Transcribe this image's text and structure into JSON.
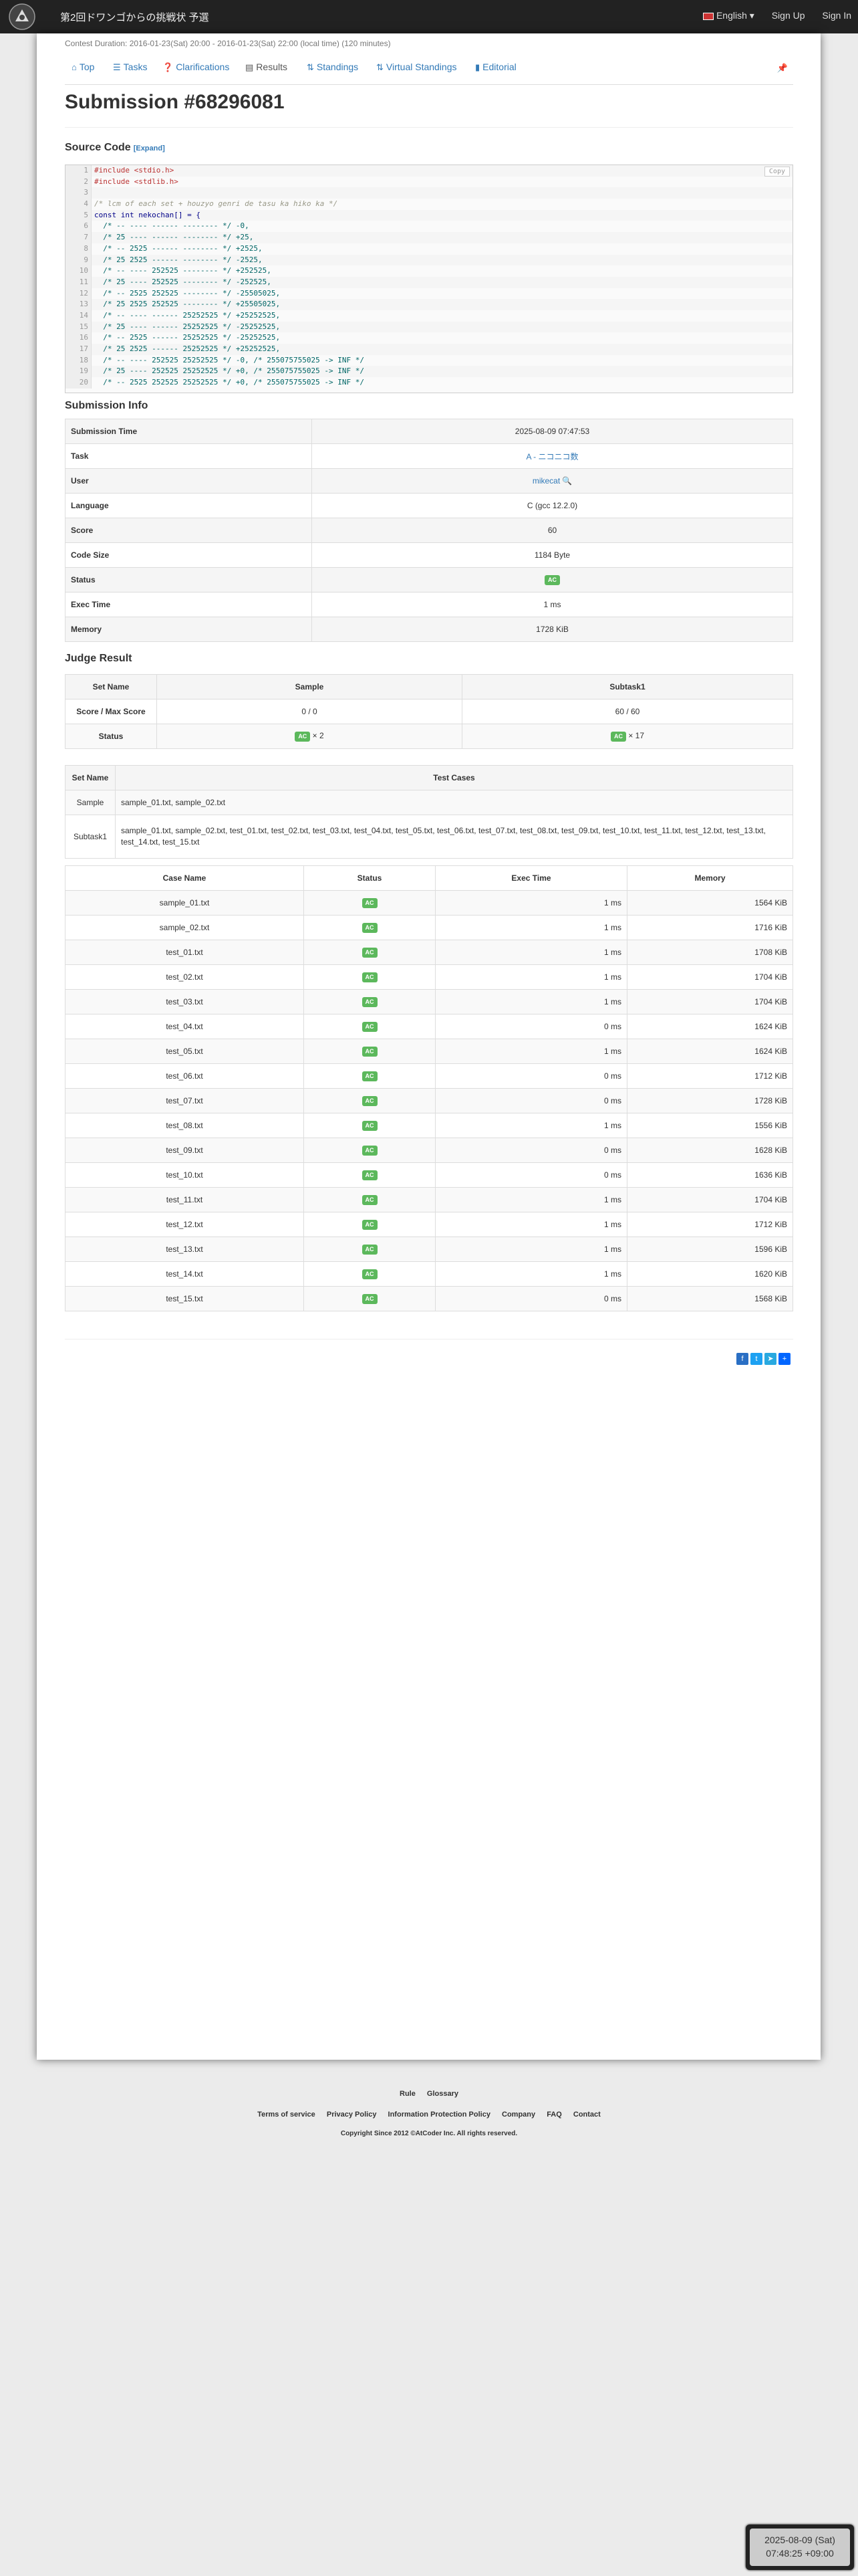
{
  "navbar": {
    "brand": "第2回ドワンゴからの挑戦状 予選",
    "language": "English",
    "sign_up": "Sign Up",
    "sign_in": "Sign In"
  },
  "contest_duration": "Contest Duration: 2016-01-23(Sat) 20:00 - 2016-01-23(Sat) 22:00 (local time) (120 minutes)",
  "tabs": [
    "Top",
    "Tasks",
    "Clarifications",
    "Results",
    "Standings",
    "Virtual Standings",
    "Editorial"
  ],
  "title": "Submission #68296081",
  "source_code": {
    "heading": "Source Code",
    "expand": "[Expand]",
    "copy": "Copy",
    "lines": [
      "#include <stdio.h>",
      "#include <stdlib.h>",
      "",
      "/* lcm of each set + houzyo genri de tasu ka hiko ka */",
      "const int nekochan[] = {",
      "  /* -- ---- ------ -------- */ -0,",
      "  /* 25 ---- ------ -------- */ +25,",
      "  /* -- 2525 ------ -------- */ +2525,",
      "  /* 25 2525 ------ -------- */ -2525,",
      "  /* -- ---- 252525 -------- */ +252525,",
      "  /* 25 ---- 252525 -------- */ -252525,",
      "  /* -- 2525 252525 -------- */ -25505025,",
      "  /* 25 2525 252525 -------- */ +25505025,",
      "  /* -- ---- ------ 25252525 */ +25252525,",
      "  /* 25 ---- ------ 25252525 */ -25252525,",
      "  /* -- 2525 ------ 25252525 */ -25252525,",
      "  /* 25 2525 ------ 25252525 */ +25252525,",
      "  /* -- ---- 252525 25252525 */ -0, /* 255075755025 -> INF */",
      "  /* 25 ---- 252525 25252525 */ +0, /* 255075755025 -> INF */",
      "  /* -- 2525 252525 25252525 */ +0, /* 255075755025 -> INF */"
    ]
  },
  "submission_info": {
    "heading": "Submission Info",
    "rows": [
      {
        "key": "Submission Time",
        "value": "2025-08-09 07:47:53"
      },
      {
        "key": "Task",
        "value": "A - ニコニコ数"
      },
      {
        "key": "User",
        "value": "mikecat"
      },
      {
        "key": "Language",
        "value": "C (gcc 12.2.0)"
      },
      {
        "key": "Score",
        "value": "60"
      },
      {
        "key": "Code Size",
        "value": "1184 Byte"
      },
      {
        "key": "Status",
        "value": "AC"
      },
      {
        "key": "Exec Time",
        "value": "1 ms"
      },
      {
        "key": "Memory",
        "value": "1728 KiB"
      }
    ]
  },
  "judge_result": {
    "heading": "Judge Result",
    "headers": [
      "Set Name",
      "Sample",
      "Subtask1"
    ],
    "score_row": {
      "label": "Score / Max Score",
      "sample": "0 / 0",
      "subtask1": "60 / 60"
    },
    "status_row": {
      "label": "Status",
      "sample_badge": "AC",
      "sample_count": "× 2",
      "subtask1_badge": "AC",
      "subtask1_count": "× 17"
    }
  },
  "test_cases_table": {
    "headers": [
      "Set Name",
      "Test Cases"
    ],
    "rows": [
      {
        "set": "Sample",
        "cases": "sample_01.txt, sample_02.txt"
      },
      {
        "set": "Subtask1",
        "cases": "sample_01.txt, sample_02.txt, test_01.txt, test_02.txt, test_03.txt, test_04.txt, test_05.txt, test_06.txt, test_07.txt, test_08.txt, test_09.txt, test_10.txt, test_11.txt, test_12.txt, test_13.txt, test_14.txt, test_15.txt"
      }
    ]
  },
  "case_results": {
    "headers": [
      "Case Name",
      "Status",
      "Exec Time",
      "Memory"
    ],
    "rows": [
      {
        "name": "sample_01.txt",
        "status": "AC",
        "time": "1 ms",
        "memory": "1564 KiB"
      },
      {
        "name": "sample_02.txt",
        "status": "AC",
        "time": "1 ms",
        "memory": "1716 KiB"
      },
      {
        "name": "test_01.txt",
        "status": "AC",
        "time": "1 ms",
        "memory": "1708 KiB"
      },
      {
        "name": "test_02.txt",
        "status": "AC",
        "time": "1 ms",
        "memory": "1704 KiB"
      },
      {
        "name": "test_03.txt",
        "status": "AC",
        "time": "1 ms",
        "memory": "1704 KiB"
      },
      {
        "name": "test_04.txt",
        "status": "AC",
        "time": "0 ms",
        "memory": "1624 KiB"
      },
      {
        "name": "test_05.txt",
        "status": "AC",
        "time": "1 ms",
        "memory": "1624 KiB"
      },
      {
        "name": "test_06.txt",
        "status": "AC",
        "time": "0 ms",
        "memory": "1712 KiB"
      },
      {
        "name": "test_07.txt",
        "status": "AC",
        "time": "0 ms",
        "memory": "1728 KiB"
      },
      {
        "name": "test_08.txt",
        "status": "AC",
        "time": "1 ms",
        "memory": "1556 KiB"
      },
      {
        "name": "test_09.txt",
        "status": "AC",
        "time": "0 ms",
        "memory": "1628 KiB"
      },
      {
        "name": "test_10.txt",
        "status": "AC",
        "time": "0 ms",
        "memory": "1636 KiB"
      },
      {
        "name": "test_11.txt",
        "status": "AC",
        "time": "1 ms",
        "memory": "1704 KiB"
      },
      {
        "name": "test_12.txt",
        "status": "AC",
        "time": "1 ms",
        "memory": "1712 KiB"
      },
      {
        "name": "test_13.txt",
        "status": "AC",
        "time": "1 ms",
        "memory": "1596 KiB"
      },
      {
        "name": "test_14.txt",
        "status": "AC",
        "time": "1 ms",
        "memory": "1620 KiB"
      },
      {
        "name": "test_15.txt",
        "status": "AC",
        "time": "0 ms",
        "memory": "1568 KiB"
      }
    ]
  },
  "footer": {
    "row1": [
      "Rule",
      "Glossary"
    ],
    "row2": [
      "Terms of service",
      "Privacy Policy",
      "Information Protection Policy",
      "Company",
      "FAQ",
      "Contact"
    ],
    "copyright": "Copyright Since 2012 ©AtCoder Inc. All rights reserved."
  },
  "clock": {
    "date": "2025-08-09 (Sat)",
    "time": "07:48:25 +09:00"
  },
  "colors": {
    "accent": "#337ab7",
    "ac_badge": "#5cb85c",
    "navbar": "#222222"
  }
}
